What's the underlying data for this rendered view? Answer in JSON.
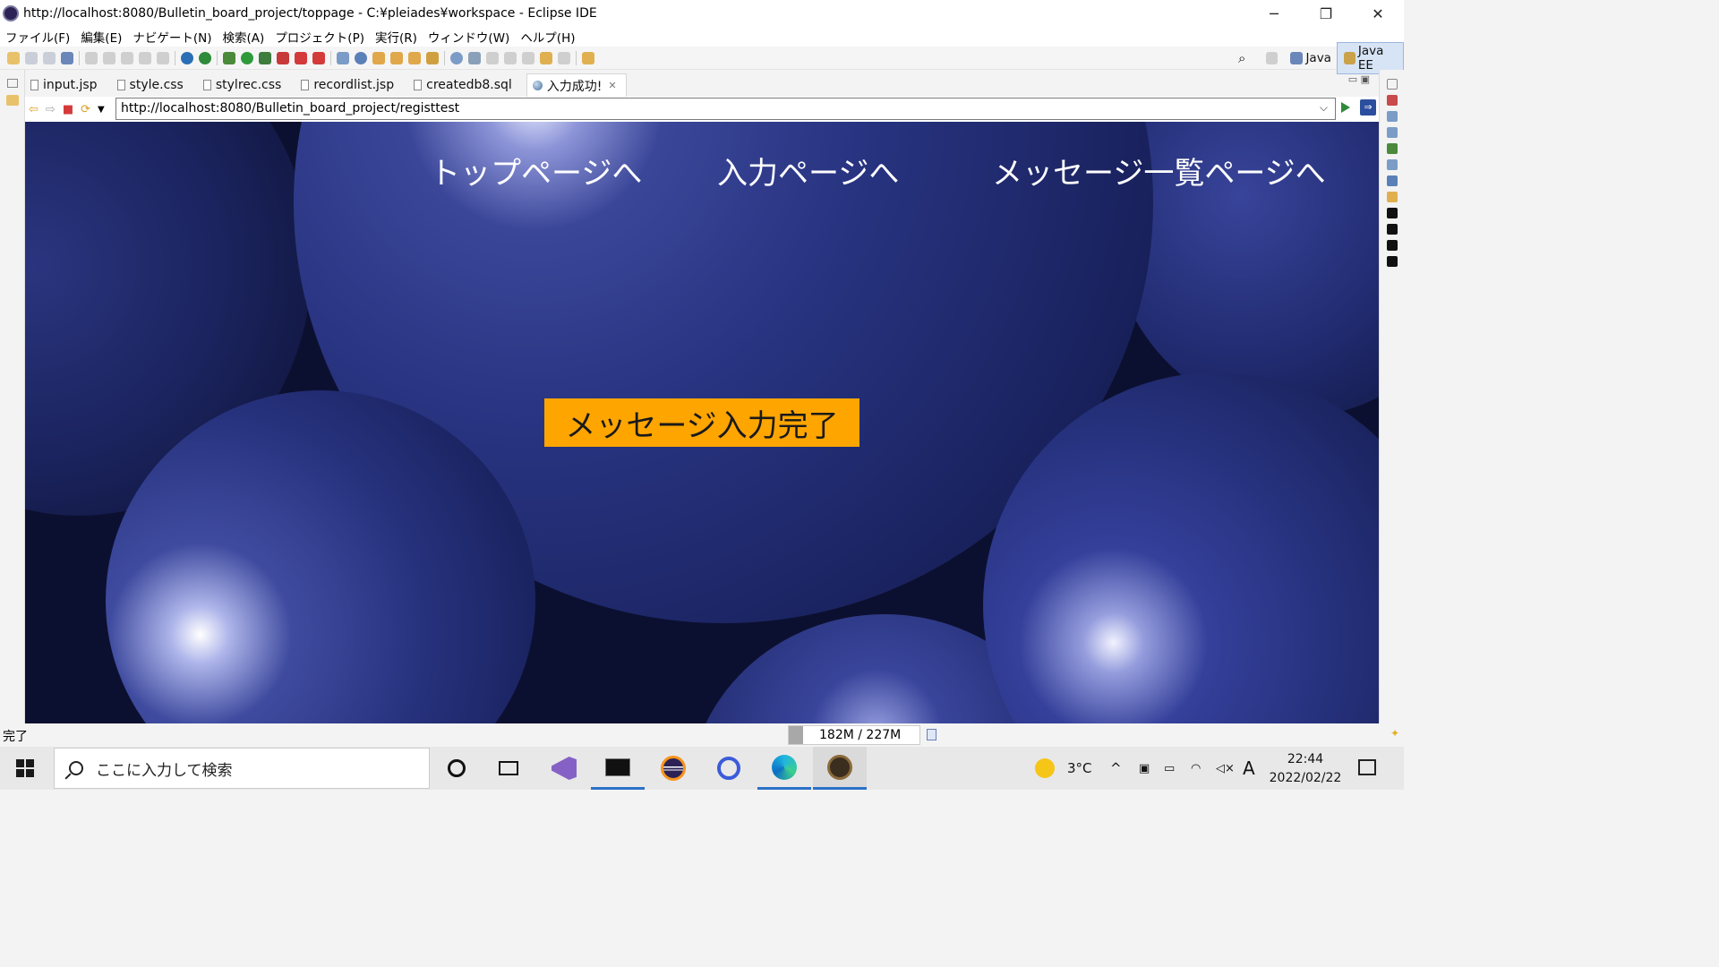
{
  "window": {
    "title": "http://localhost:8080/Bulletin_board_project/toppage - C:¥pleiades¥workspace - Eclipse IDE",
    "controls": [
      "─",
      "❐",
      "✕"
    ]
  },
  "menu": [
    "ファイル(F)",
    "編集(E)",
    "ナビゲート(N)",
    "検索(A)",
    "プロジェクト(P)",
    "実行(R)",
    "ウィンドウ(W)",
    "ヘルプ(H)"
  ],
  "perspectives": {
    "java": "Java",
    "java_ee": "Java EE"
  },
  "tabs": [
    {
      "label": "input.jsp"
    },
    {
      "label": "style.css"
    },
    {
      "label": "stylrec.css"
    },
    {
      "label": "recordlist.jsp"
    },
    {
      "label": "createdb8.sql"
    },
    {
      "label": "入力成功!",
      "active": true
    }
  ],
  "browser": {
    "url": "http://localhost:8080/Bulletin_board_project/registtest"
  },
  "page": {
    "nav": [
      "トップページへ",
      "入力ページへ",
      "メッセージ一覧ページへ"
    ],
    "message": "メッセージ入力完了"
  },
  "status": {
    "text": "完了",
    "heap": "182M / 227M"
  },
  "taskbar": {
    "search_placeholder": "ここに入力して検索",
    "weather": "3°C",
    "ime": "A",
    "time": "22:44",
    "date": "2022/02/22"
  },
  "colors": {
    "accent_orange": "#ffa500",
    "background_blue": "#27337f"
  }
}
